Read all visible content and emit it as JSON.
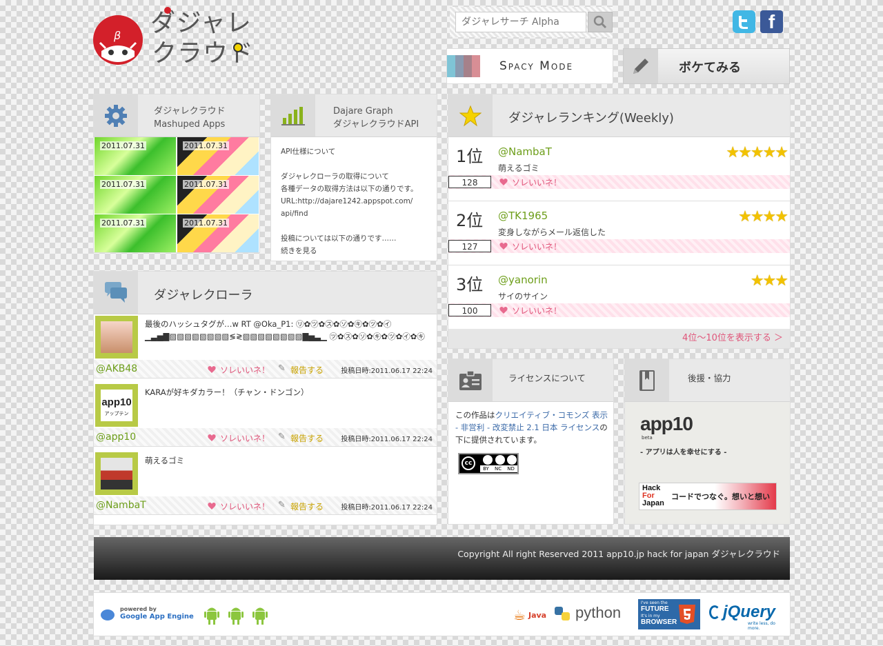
{
  "header": {
    "logo_line1": "ダジャレ",
    "logo_line2": "クラウド",
    "mascot_badge": "β",
    "search_placeholder": "ダジャレサーチ Alpha",
    "spacy_label": "Spacy Mode",
    "boke_label": "ボケてみる"
  },
  "colors": {
    "accent_green": "#6d9e1a",
    "accent_pink": "#e0557a",
    "mascot_red": "#d3202a",
    "star_yellow": "#f2c200"
  },
  "mashup": {
    "title1": "ダジャレクラウド",
    "title2": "Mashuped Apps",
    "icon": "gear-icon",
    "dates": [
      "2011.07.31",
      "2011.07.31",
      "2011.07.31",
      "2011.07.31",
      "2011.07.31",
      "2011.07.31"
    ]
  },
  "graph": {
    "title1": "Dajare Graph",
    "title2": "ダジャレクラウドAPI",
    "icon": "bar-chart-icon",
    "lines": [
      "API仕様について",
      "",
      "ダジャレクローラの取得について",
      "各種データの取得方法は以下の通りです。",
      "URL:http://dajare1242.appspot.com/",
      "api/find",
      "",
      "投稿については以下の通りです……",
      "続きを見る"
    ]
  },
  "ranking": {
    "title": "ダジャレランキング(Weekly)",
    "icon": "star-icon",
    "like_label": "ソレいいネ！",
    "items": [
      {
        "pos": "1位",
        "user": "@NambaT",
        "text": "萌えるゴミ",
        "count": "128",
        "stars": "★★★★★"
      },
      {
        "pos": "2位",
        "user": "@TK1965",
        "text": "変身しながらメール返信した",
        "count": "127",
        "stars": "★★★★"
      },
      {
        "pos": "3位",
        "user": "@yanorin",
        "text": "サイのサイン",
        "count": "100",
        "stars": "★★★"
      }
    ],
    "more": "4位〜10位を表示する ＞"
  },
  "crawler": {
    "title": "ダジャレクローラ",
    "icon": "chat-bubble-icon",
    "like_label": "ソレいいネ！",
    "report_label": "報告する",
    "items": [
      {
        "text": "最後のハッシュタグが…w RT @Oka_P1: ㋷✿㋡✿㋜✿㋞✿㋖✿㋡✿㋑ ▁▃▅▇▧▧▧▧▧▧▧▧≶≷▧▧▧▧▧▧▧▧▇▅▃▁ ㋡✿㋜✿㋞✿㋖✿㋡✿㋑✿㋖",
        "user": "@AKB48",
        "date": "投稿日時:2011.06.17 22:24"
      },
      {
        "text": "KARAが好キダカラー！（チャン・ドンゴン）",
        "user": "@app10",
        "avatar_text": "app10",
        "avatar_sub": "アップテン",
        "date": "投稿日時:2011.06.17 22:24"
      },
      {
        "text": "萌えるゴミ",
        "user": "@NambaT",
        "date": "投稿日時:2011.06.17 22:24"
      }
    ]
  },
  "license": {
    "title": "ライセンスについて",
    "icon": "id-card-icon",
    "text_before": "この作品は",
    "link": "クリエイティブ・コモンズ 表示 - 非営利 - 改変禁止 2.1 日本 ライセンス",
    "text_after": "の下に提供されています。",
    "badge_cc": "cc",
    "badge_by": "BY",
    "badge_nc": "NC",
    "badge_nd": "ND"
  },
  "support": {
    "title": "後援・協力",
    "icon": "book-icon",
    "app10_logo": "app10",
    "app10_beta": "beta",
    "app10_tagline": "- アプリは人を幸せにする -",
    "hfj_logo_1": "Hack",
    "hfj_logo_2": "For",
    "hfj_logo_3": "Japan",
    "hfj_text": "コードでつなぐ。想いと想い"
  },
  "footer": {
    "copyright": "Copyright All right Reserved 2011 app10.jp hack for japan ダジャレクラウド",
    "gae_small": "powered by",
    "gae_big": "Google App Engine",
    "java": "Java",
    "python": "python",
    "future_1": "I've seen the",
    "future_2": "FUTURE",
    "future_3": "It's in my",
    "future_4": "BROWSER",
    "jquery": "jQuery",
    "jquery_tag": "write less, do more."
  }
}
